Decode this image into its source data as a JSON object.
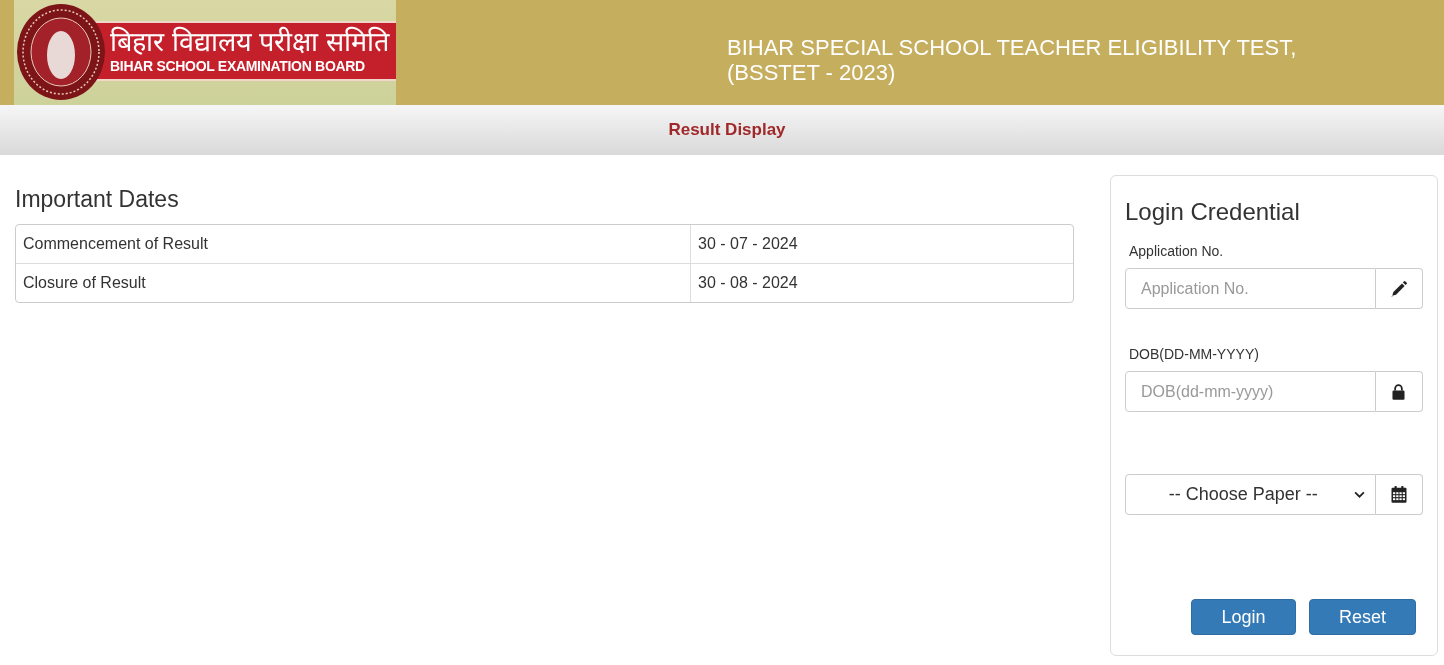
{
  "header": {
    "logo": {
      "hindi_text": "बिहार विद्यालय परीक्षा समिति",
      "english_text": "BIHAR SCHOOL EXAMINATION BOARD"
    },
    "title_lines": [
      "BIHAR SPECIAL SCHOOL TEACHER ELIGIBILITY TEST,",
      "(BSSTET - 2023)"
    ]
  },
  "nav": {
    "title": "Result Display"
  },
  "important_dates": {
    "heading": "Important Dates",
    "rows": [
      {
        "event": "Commencement of Result",
        "date": "30 - 07 - 2024"
      },
      {
        "event": "Closure of Result",
        "date": "30 - 08 - 2024"
      }
    ]
  },
  "login": {
    "heading": "Login Credential",
    "fields": [
      {
        "kind": "text",
        "label": "Application No.",
        "placeholder": "Application No."
      },
      {
        "kind": "text",
        "label": "DOB(DD-MM-YYYY)",
        "placeholder": "DOB(dd-mm-yyyy)"
      },
      {
        "kind": "select",
        "value": "-- Choose Paper --"
      }
    ],
    "buttons": [
      "Login",
      "Reset"
    ]
  }
}
